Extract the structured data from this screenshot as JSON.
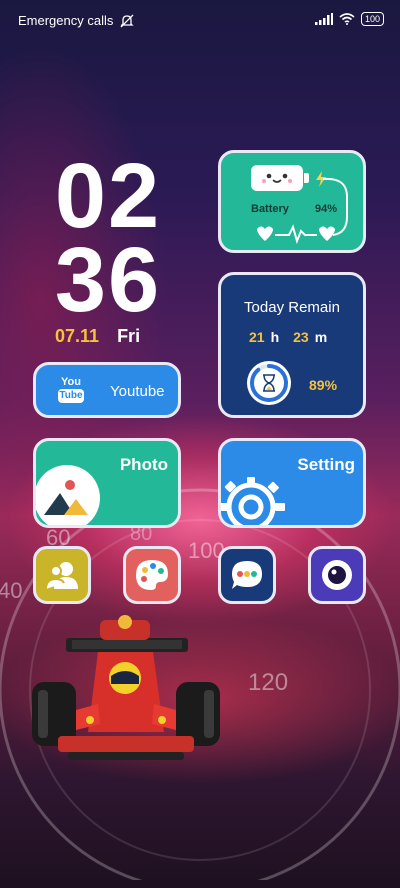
{
  "status_bar": {
    "carrier": "Emergency calls",
    "battery": "100"
  },
  "clock": {
    "hour": "02",
    "minute": "36",
    "date": "07.11",
    "weekday": "Fri"
  },
  "battery_widget": {
    "label": "Battery",
    "percent": "94%"
  },
  "today_remain": {
    "title": "Today Remain",
    "hours": "21",
    "h_unit": "h",
    "minutes": "23",
    "m_unit": "m",
    "percent": "89%",
    "progress": 0.89
  },
  "apps": {
    "youtube_label": "Youtube",
    "youtube_logo_top": "You",
    "youtube_logo_bottom": "Tube",
    "photo_label": "Photo",
    "setting_label": "Setting"
  },
  "speedometer_ticks": [
    "60",
    "40",
    "100",
    "120",
    "80"
  ],
  "colors": {
    "accent_yellow": "#f7c23b",
    "teal": "#23b897",
    "blue": "#2b8be6",
    "navy": "#183a78"
  }
}
